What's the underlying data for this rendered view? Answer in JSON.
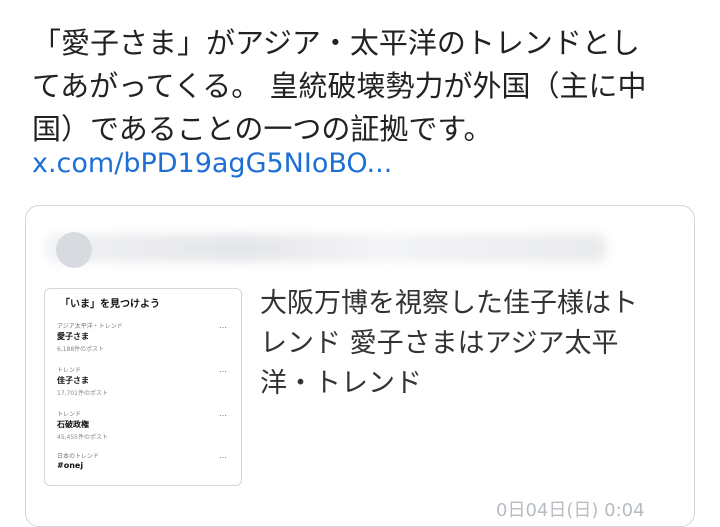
{
  "post": {
    "lines": [
      "「愛子さま」がアジア・太平洋のトレンドとし",
      "てあがってくる。 皇統破壊勢力が外国（主に中",
      "国）であることの一つの証拠です。"
    ],
    "link": "x.com/bPD19agG5NIoBO..."
  },
  "quote": {
    "text_lines": [
      "大阪万博を視察した佳子様はト",
      "レンド 愛子さまはアジア太平",
      "洋・トレンド"
    ],
    "time": "0日04日(日) 0:04"
  },
  "thumbnail": {
    "title": "「いま」を見つけよう",
    "trends": [
      {
        "meta": "アジア太平洋・トレンド",
        "name": "愛子さま",
        "count": "6,188件のポスト"
      },
      {
        "meta": "トレンド",
        "name": "佳子さま",
        "count": "17,701件のポスト"
      },
      {
        "meta": "トレンド",
        "name": "石破政権",
        "count": "45,455件のポスト"
      },
      {
        "meta": "日本のトレンド",
        "name": "#onej",
        "count": ""
      }
    ],
    "more": "…"
  }
}
